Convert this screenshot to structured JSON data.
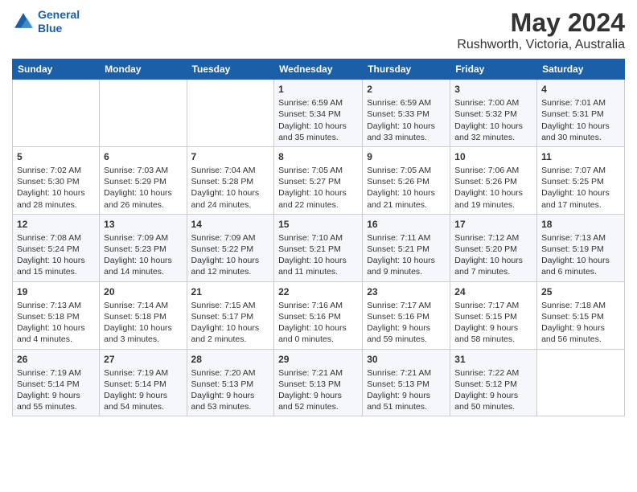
{
  "logo": {
    "line1": "General",
    "line2": "Blue"
  },
  "title": "May 2024",
  "subtitle": "Rushworth, Victoria, Australia",
  "days_of_week": [
    "Sunday",
    "Monday",
    "Tuesday",
    "Wednesday",
    "Thursday",
    "Friday",
    "Saturday"
  ],
  "weeks": [
    [
      {
        "day": "",
        "info": ""
      },
      {
        "day": "",
        "info": ""
      },
      {
        "day": "",
        "info": ""
      },
      {
        "day": "1",
        "sunrise": "6:59 AM",
        "sunset": "5:34 PM",
        "daylight": "10 hours and 35 minutes."
      },
      {
        "day": "2",
        "sunrise": "6:59 AM",
        "sunset": "5:33 PM",
        "daylight": "10 hours and 33 minutes."
      },
      {
        "day": "3",
        "sunrise": "7:00 AM",
        "sunset": "5:32 PM",
        "daylight": "10 hours and 32 minutes."
      },
      {
        "day": "4",
        "sunrise": "7:01 AM",
        "sunset": "5:31 PM",
        "daylight": "10 hours and 30 minutes."
      }
    ],
    [
      {
        "day": "5",
        "sunrise": "7:02 AM",
        "sunset": "5:30 PM",
        "daylight": "10 hours and 28 minutes."
      },
      {
        "day": "6",
        "sunrise": "7:03 AM",
        "sunset": "5:29 PM",
        "daylight": "10 hours and 26 minutes."
      },
      {
        "day": "7",
        "sunrise": "7:04 AM",
        "sunset": "5:28 PM",
        "daylight": "10 hours and 24 minutes."
      },
      {
        "day": "8",
        "sunrise": "7:05 AM",
        "sunset": "5:27 PM",
        "daylight": "10 hours and 22 minutes."
      },
      {
        "day": "9",
        "sunrise": "7:05 AM",
        "sunset": "5:26 PM",
        "daylight": "10 hours and 21 minutes."
      },
      {
        "day": "10",
        "sunrise": "7:06 AM",
        "sunset": "5:26 PM",
        "daylight": "10 hours and 19 minutes."
      },
      {
        "day": "11",
        "sunrise": "7:07 AM",
        "sunset": "5:25 PM",
        "daylight": "10 hours and 17 minutes."
      }
    ],
    [
      {
        "day": "12",
        "sunrise": "7:08 AM",
        "sunset": "5:24 PM",
        "daylight": "10 hours and 15 minutes."
      },
      {
        "day": "13",
        "sunrise": "7:09 AM",
        "sunset": "5:23 PM",
        "daylight": "10 hours and 14 minutes."
      },
      {
        "day": "14",
        "sunrise": "7:09 AM",
        "sunset": "5:22 PM",
        "daylight": "10 hours and 12 minutes."
      },
      {
        "day": "15",
        "sunrise": "7:10 AM",
        "sunset": "5:21 PM",
        "daylight": "10 hours and 11 minutes."
      },
      {
        "day": "16",
        "sunrise": "7:11 AM",
        "sunset": "5:21 PM",
        "daylight": "10 hours and 9 minutes."
      },
      {
        "day": "17",
        "sunrise": "7:12 AM",
        "sunset": "5:20 PM",
        "daylight": "10 hours and 7 minutes."
      },
      {
        "day": "18",
        "sunrise": "7:13 AM",
        "sunset": "5:19 PM",
        "daylight": "10 hours and 6 minutes."
      }
    ],
    [
      {
        "day": "19",
        "sunrise": "7:13 AM",
        "sunset": "5:18 PM",
        "daylight": "10 hours and 4 minutes."
      },
      {
        "day": "20",
        "sunrise": "7:14 AM",
        "sunset": "5:18 PM",
        "daylight": "10 hours and 3 minutes."
      },
      {
        "day": "21",
        "sunrise": "7:15 AM",
        "sunset": "5:17 PM",
        "daylight": "10 hours and 2 minutes."
      },
      {
        "day": "22",
        "sunrise": "7:16 AM",
        "sunset": "5:16 PM",
        "daylight": "10 hours and 0 minutes."
      },
      {
        "day": "23",
        "sunrise": "7:17 AM",
        "sunset": "5:16 PM",
        "daylight": "9 hours and 59 minutes."
      },
      {
        "day": "24",
        "sunrise": "7:17 AM",
        "sunset": "5:15 PM",
        "daylight": "9 hours and 58 minutes."
      },
      {
        "day": "25",
        "sunrise": "7:18 AM",
        "sunset": "5:15 PM",
        "daylight": "9 hours and 56 minutes."
      }
    ],
    [
      {
        "day": "26",
        "sunrise": "7:19 AM",
        "sunset": "5:14 PM",
        "daylight": "9 hours and 55 minutes."
      },
      {
        "day": "27",
        "sunrise": "7:19 AM",
        "sunset": "5:14 PM",
        "daylight": "9 hours and 54 minutes."
      },
      {
        "day": "28",
        "sunrise": "7:20 AM",
        "sunset": "5:13 PM",
        "daylight": "9 hours and 53 minutes."
      },
      {
        "day": "29",
        "sunrise": "7:21 AM",
        "sunset": "5:13 PM",
        "daylight": "9 hours and 52 minutes."
      },
      {
        "day": "30",
        "sunrise": "7:21 AM",
        "sunset": "5:13 PM",
        "daylight": "9 hours and 51 minutes."
      },
      {
        "day": "31",
        "sunrise": "7:22 AM",
        "sunset": "5:12 PM",
        "daylight": "9 hours and 50 minutes."
      },
      {
        "day": "",
        "info": ""
      }
    ]
  ]
}
